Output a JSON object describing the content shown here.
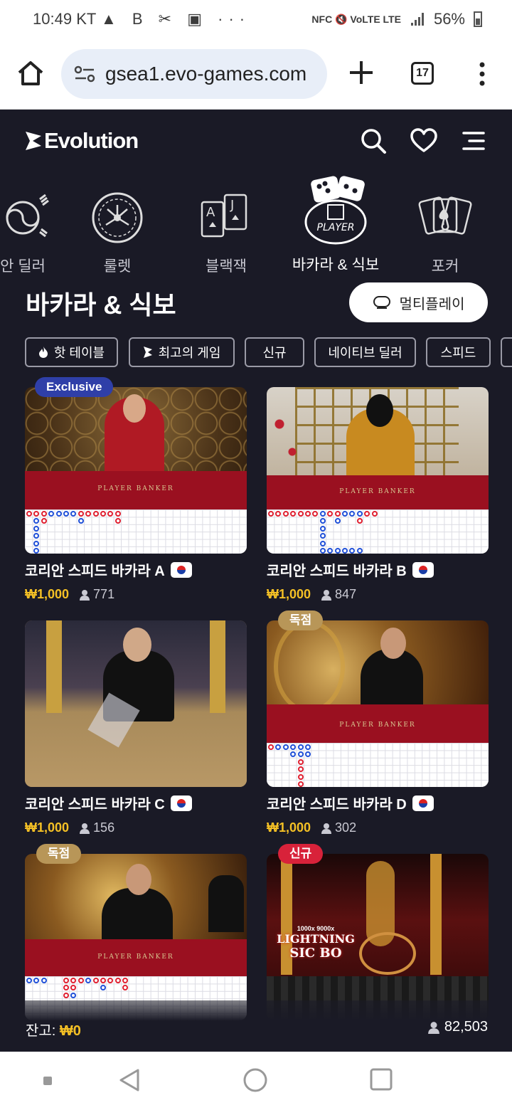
{
  "status_bar": {
    "time": "10:49",
    "carrier": "KT",
    "battery": "56%",
    "left_icons": "▲ B ✂ ▣ ···",
    "right_icons": "NFC 🔇 VoLTE LTE"
  },
  "browser": {
    "url": "gsea1.evo-games.com",
    "tab_count": "17"
  },
  "site": {
    "brand": "Evolution"
  },
  "categories": [
    {
      "label": "안 딜러",
      "icon": "korean-dealer-icon"
    },
    {
      "label": "룰렛",
      "icon": "roulette-icon"
    },
    {
      "label": "블랙잭",
      "icon": "blackjack-cards-icon"
    },
    {
      "label": "바카라 & 식보",
      "icon": "dice-player-icon"
    },
    {
      "label": "포커",
      "icon": "poker-cards-icon"
    }
  ],
  "page": {
    "title": "바카라 & 식보",
    "multiplay_label": "멀티플레이"
  },
  "filters": [
    "핫 테이블",
    "최고의 게임",
    "신규",
    "네이티브 딜러",
    "스피드"
  ],
  "games": [
    {
      "name": "코리안 스피드 바카라 A",
      "price": "₩1,000",
      "players": "771",
      "badge": "Exclusive",
      "badge_color": "#2f3fa8"
    },
    {
      "name": "코리안 스피드 바카라 B",
      "price": "₩1,000",
      "players": "847",
      "badge": "",
      "badge_color": ""
    },
    {
      "name": "코리안 스피드 바카라 C",
      "price": "₩1,000",
      "players": "156",
      "badge": "",
      "badge_color": ""
    },
    {
      "name": "코리안 스피드 바카라 D",
      "price": "₩1,000",
      "players": "302",
      "badge": "독점",
      "badge_color": "#b89658"
    },
    {
      "name": "",
      "price": "",
      "players": "",
      "badge": "독점",
      "badge_color": "#b89658"
    },
    {
      "name": "",
      "price": "",
      "players": "",
      "badge": "신규",
      "badge_color": "#d8223a"
    }
  ],
  "thumb_texts": {
    "player": "PLAYER",
    "banker": "BANKER",
    "sicbo_title": "LIGHTNING",
    "sicbo_sub": "SIC BO",
    "multipliers": "1000x 9000x"
  },
  "footer": {
    "balance_label": "잔고: ",
    "balance_value": "₩0",
    "total_players": "82,503"
  },
  "colors": {
    "background": "#1a1a26",
    "accent_gold": "#f4c025",
    "exclusive_badge": "#2f3fa8",
    "new_badge": "#d8223a"
  }
}
